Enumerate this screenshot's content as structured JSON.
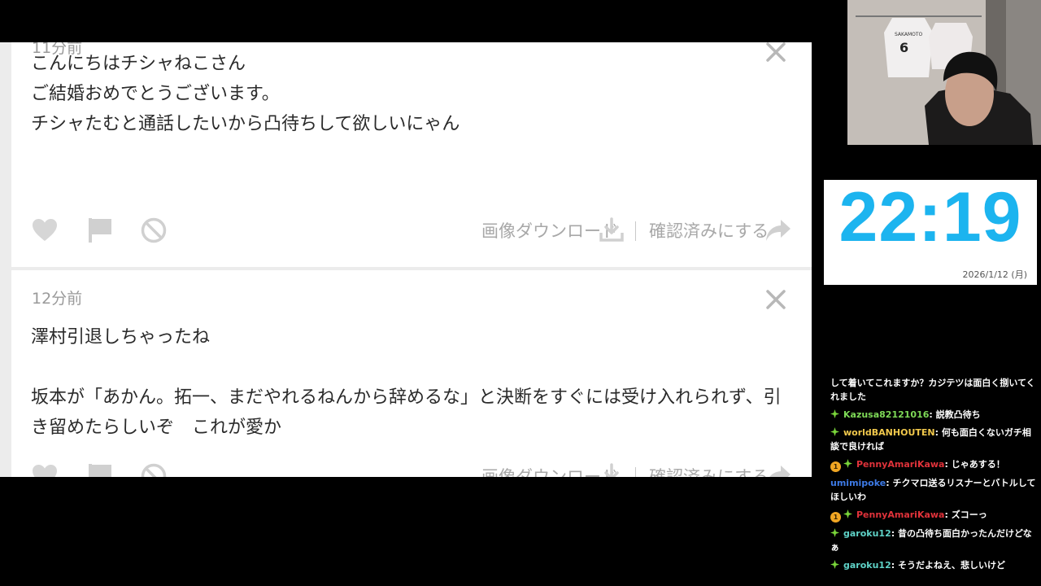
{
  "messages": [
    {
      "time": "11分前",
      "body": "こんにちはチシャねこさん\nご結婚おめでとうございます。\nチシャたむと通話したいから凸待ちして欲しいにゃん"
    },
    {
      "time": "12分前",
      "body": "澤村引退しちゃったね\n\n坂本が「あかん。拓一、まだやれるねんから辞めるな」と決断をすぐには受け入れられず、引き留めたらしいぞ　これが愛か"
    }
  ],
  "actions": {
    "download_label": "画像ダウンロード",
    "confirm_label": "確認済みにする"
  },
  "icons": [
    "heart-icon",
    "flag-icon",
    "ban-icon",
    "download-icon",
    "share-arrow-icon",
    "close-icon"
  ],
  "clock": {
    "time": "22:19",
    "date": "2026/1/12 (月)",
    "color": "#1cb4ef"
  },
  "webcam": {
    "jersey_name": "SAKAMOTO",
    "jersey_number": "6"
  },
  "chat": [
    {
      "user": "",
      "user_color": "#ffffff",
      "text": "して着いてこれますか？カジテツは面白く捌いてくれました",
      "mod": false,
      "sub": false
    },
    {
      "user": "Kazusa82121016",
      "user_color": "#7ed957",
      "text": "説教凸待ち",
      "mod": true,
      "sub": false
    },
    {
      "user": "worldBANHOUTEN",
      "user_color": "#f2c94c",
      "text": "何も面白くないガチ相談で良ければ",
      "mod": true,
      "sub": false
    },
    {
      "user": "PennyAmariKawa",
      "user_color": "#e0323a",
      "text": "じゃあする！",
      "mod": true,
      "sub": true,
      "sub_label": "1"
    },
    {
      "user": "umimipoke",
      "user_color": "#3d7ae6",
      "text": "チクマロ送るリスナーとバトルしてほしいわ",
      "mod": false,
      "sub": false
    },
    {
      "user": "PennyAmariKawa",
      "user_color": "#e0323a",
      "text": "ズコーっ",
      "mod": true,
      "sub": true,
      "sub_label": "1"
    },
    {
      "user": "garoku12",
      "user_color": "#5fd3c8",
      "text": "昔の凸待ち面白かったんだけどなぁ",
      "mod": true,
      "sub": false
    },
    {
      "user": "garoku12",
      "user_color": "#5fd3c8",
      "text": "そうだよねえ、悲しいけど",
      "mod": true,
      "sub": false
    }
  ]
}
